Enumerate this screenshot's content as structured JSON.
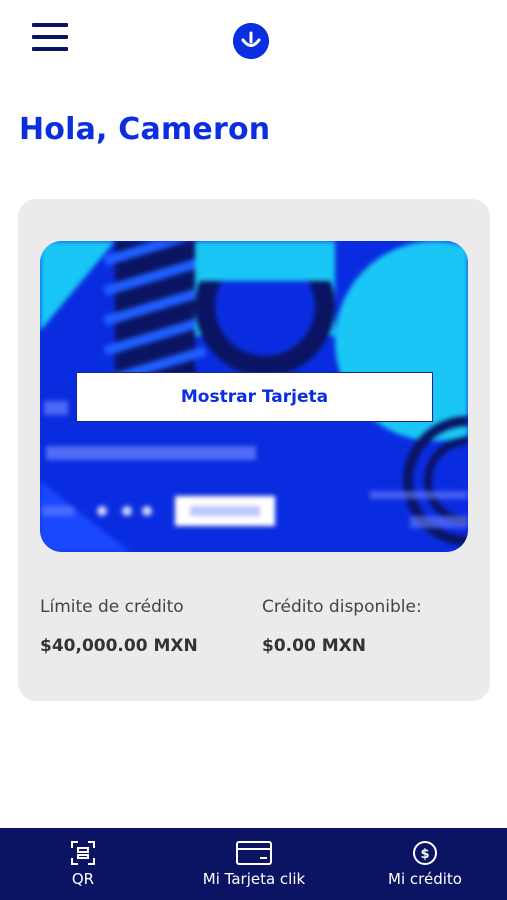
{
  "header": {
    "menu_icon": "hamburger-menu-icon",
    "logo_icon": "smiley-logo-icon"
  },
  "greeting": "Hola, Cameron",
  "card": {
    "show_button_label": "Mostrar Tarjeta"
  },
  "credit": {
    "limit_label": "Límite de crédito",
    "limit_value": "$40,000.00 MXN",
    "available_label": "Crédito disponible:",
    "available_value": "$0.00 MXN"
  },
  "bottom_nav": {
    "items": [
      {
        "label": "QR",
        "icon": "qr-scan-icon"
      },
      {
        "label": "Mi Tarjeta clik",
        "icon": "credit-card-icon"
      },
      {
        "label": "Mi crédito",
        "icon": "dollar-coin-icon"
      }
    ]
  },
  "colors": {
    "brand_blue": "#0b2fe0",
    "navy": "#0a1462",
    "cyan": "#19c6f5",
    "panel_gray": "#ebebeb"
  }
}
